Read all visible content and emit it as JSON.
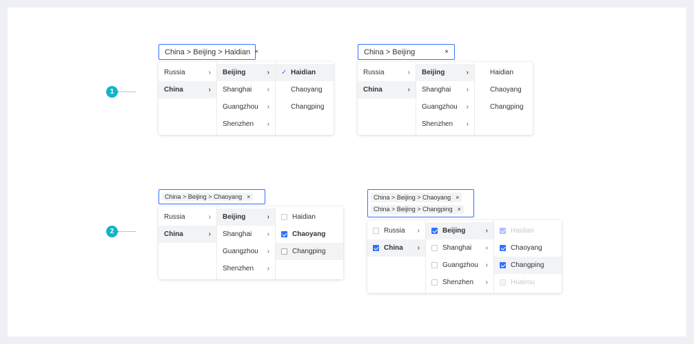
{
  "markers": [
    "1",
    "2"
  ],
  "ex1a": {
    "input_value": "China > Beijing > Haidian",
    "countries": [
      "Russia",
      "China"
    ],
    "cities": [
      "Beijing",
      "Shanghai",
      "Guangzhou",
      "Shenzhen"
    ],
    "districts": [
      "Haidian",
      "Chaoyang",
      "Changping"
    ]
  },
  "ex1b": {
    "input_value": "China > Beijing",
    "countries": [
      "Russia",
      "China"
    ],
    "cities": [
      "Beijing",
      "Shanghai",
      "Guangzhou",
      "Shenzhen"
    ],
    "districts": [
      "Haidian",
      "Chaoyang",
      "Changping"
    ]
  },
  "ex2a": {
    "tags": [
      "China > Beijing > Chaoyang"
    ],
    "countries": [
      "Russia",
      "China"
    ],
    "cities": [
      "Beijing",
      "Shanghai",
      "Guangzhou",
      "Shenzhen"
    ],
    "districts": [
      "Haidian",
      "Chaoyang",
      "Changping"
    ]
  },
  "ex2b": {
    "tags": [
      "China > Beijing > Chaoyang",
      "China > Beijing > Changping"
    ],
    "countries": [
      "Russia",
      "China"
    ],
    "cities": [
      "Beijing",
      "Shanghai",
      "Guangzhou",
      "Shenzhen"
    ],
    "districts": [
      "Haidian",
      "Chaoyang",
      "Changping",
      "Huairou"
    ]
  },
  "icons": {
    "clear": "×",
    "chevron": "›",
    "check": "✓"
  },
  "colors": {
    "accent": "#3370ff",
    "marker": "#15b3c6",
    "active_bg": "#f2f3f5"
  }
}
